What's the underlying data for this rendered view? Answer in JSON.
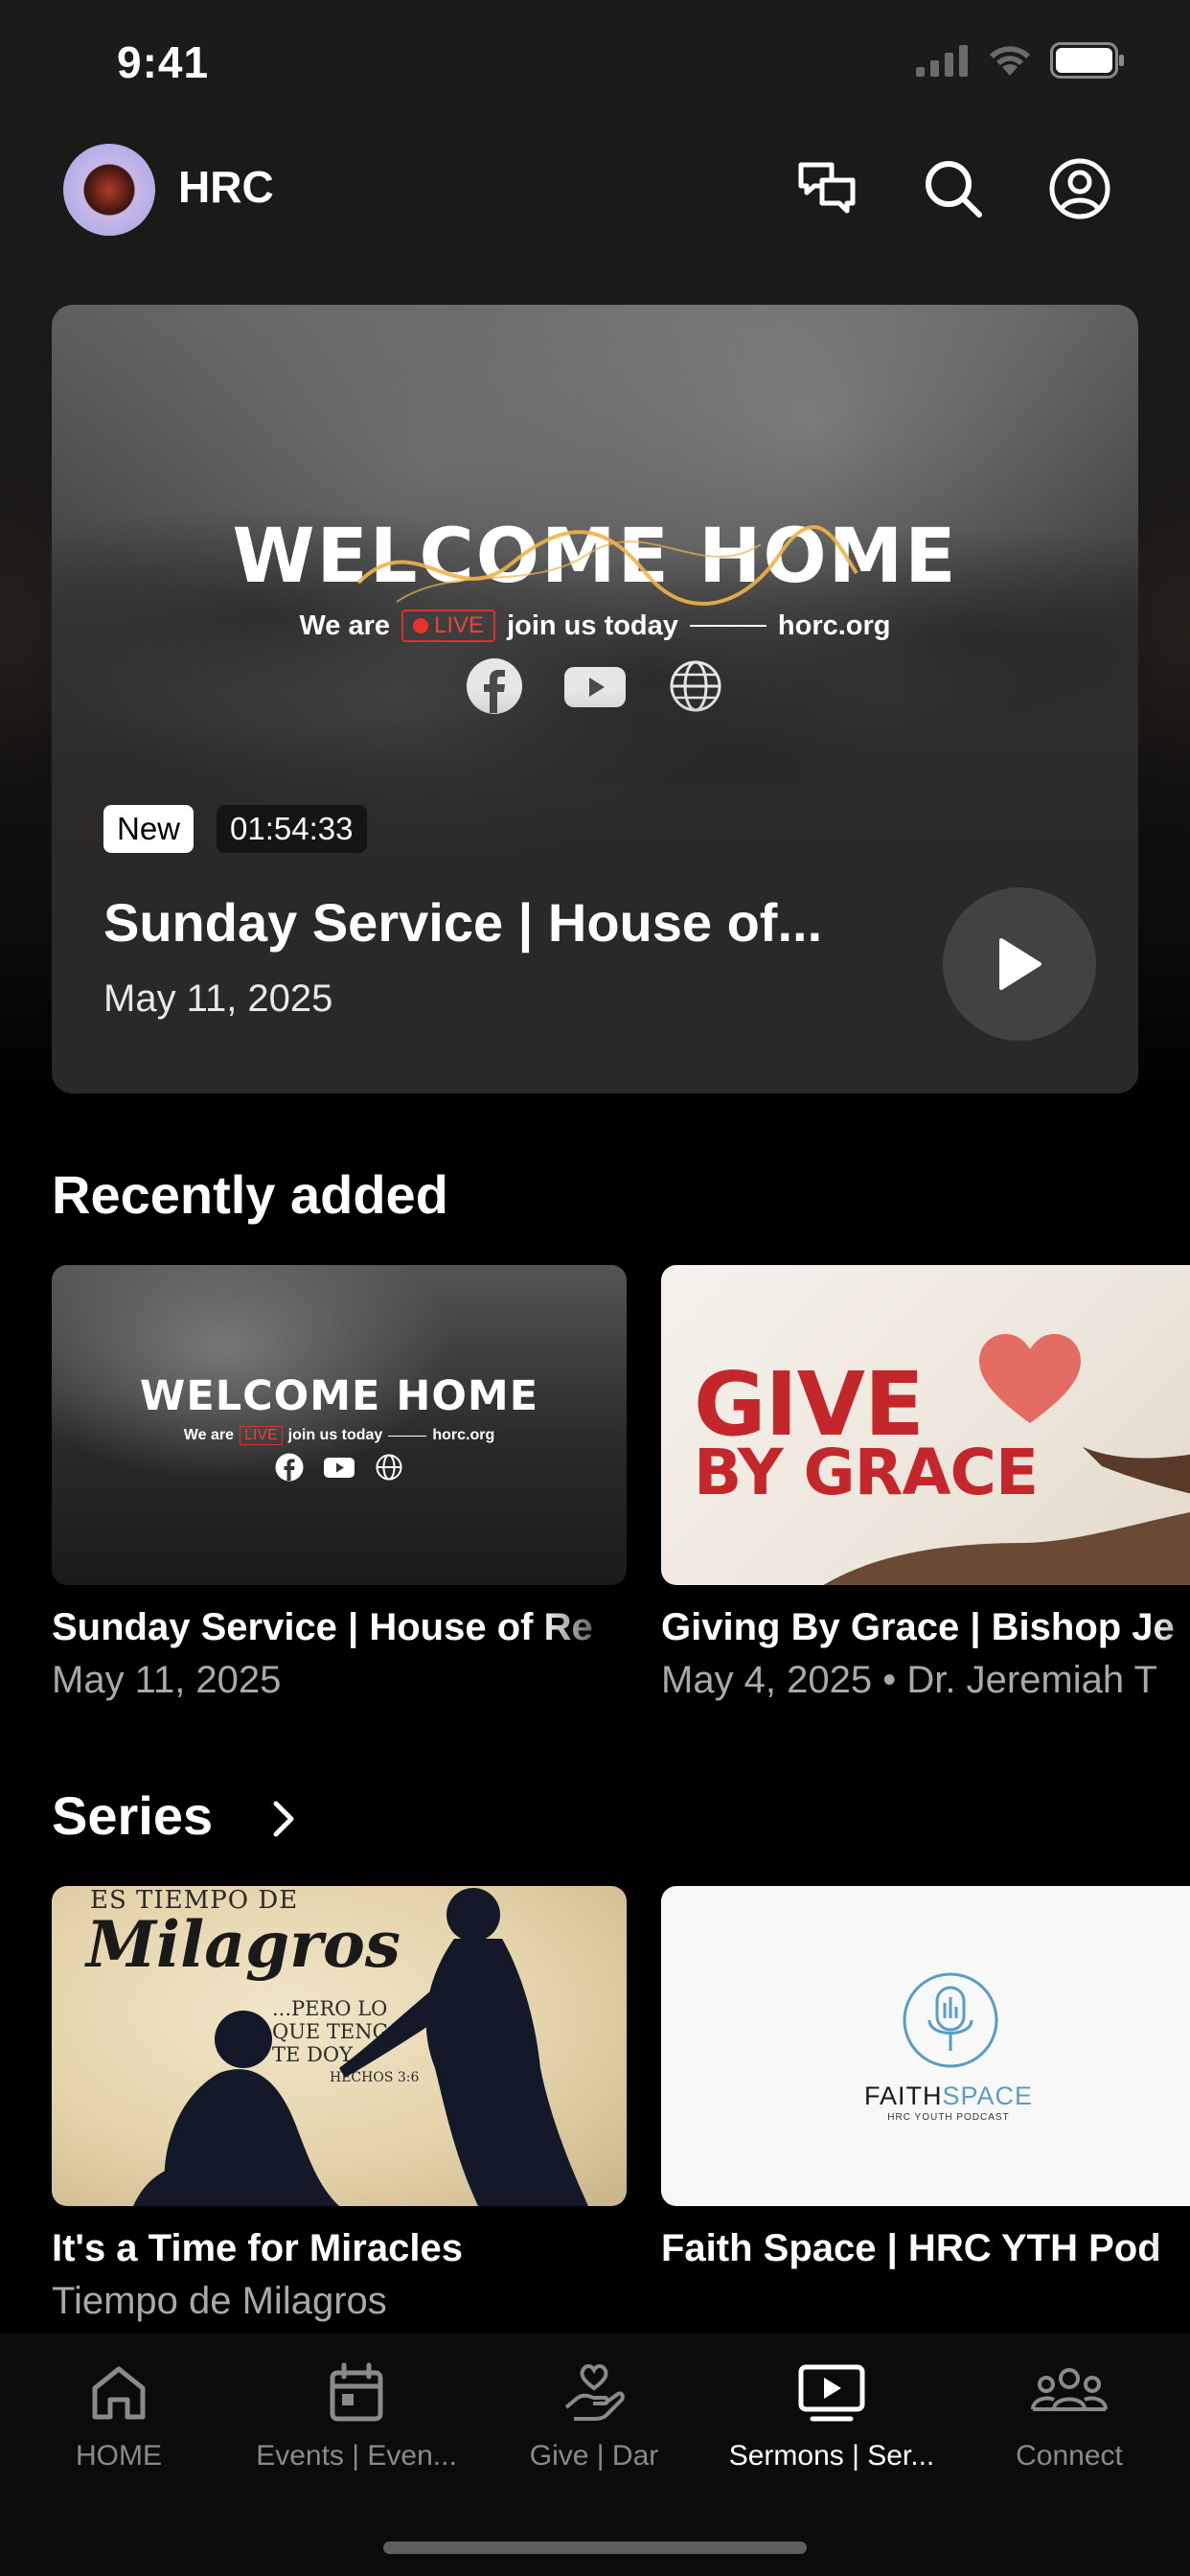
{
  "status_bar": {
    "time": "9:41"
  },
  "header": {
    "app_name": "HRC"
  },
  "hero": {
    "welcome_text": "WELCOME HOME",
    "tagline_prefix": "We are",
    "live_label": "LIVE",
    "tagline_mid": "join us today",
    "website": "horc.org",
    "badge_new": "New",
    "duration": "01:54:33",
    "title": "Sunday Service | House of...",
    "date": "May 11, 2025"
  },
  "recently_added": {
    "title": "Recently added",
    "items": [
      {
        "title": "Sunday Service | House of Re",
        "subtitle": "May 11, 2025",
        "thumb_welcome": "WELCOME HOME",
        "thumb_we_are": "We are",
        "thumb_live": "LIVE",
        "thumb_join": "join us today",
        "thumb_site": "horc.org"
      },
      {
        "title": "Giving By Grace | Bishop Je",
        "subtitle": "May 4, 2025 • Dr. Jeremiah T",
        "thumb_line1": "GIVE",
        "thumb_line2": "BY GRACE"
      }
    ]
  },
  "series": {
    "title": "Series",
    "items": [
      {
        "title": "It's a Time for Miracles",
        "subtitle": "Tiempo de Milagros",
        "thumb_top": "ES TIEMPO DE",
        "thumb_script": "Milagros",
        "thumb_quote_1": "...PERO LO",
        "thumb_quote_2": "QUE TENGO",
        "thumb_quote_3": "TE DOY...\"",
        "thumb_ref": "HECHOS 3:6"
      },
      {
        "title": "Faith Space | HRC YTH Pod",
        "subtitle": "",
        "thumb_brand_1": "FAITH",
        "thumb_brand_2": "SPACE",
        "thumb_caption": "HRC YOUTH PODCAST"
      }
    ]
  },
  "tabbar": {
    "tabs": [
      {
        "label": "HOME",
        "icon": "home-icon"
      },
      {
        "label": "Events | Even...",
        "icon": "calendar-icon"
      },
      {
        "label": "Give | Dar",
        "icon": "give-hand-icon"
      },
      {
        "label": "Sermons | Ser...",
        "icon": "video-play-icon",
        "active": true
      },
      {
        "label": "Connect",
        "icon": "people-icon"
      }
    ]
  },
  "colors": {
    "accent_red": "#c4272b",
    "live_red": "#e8332b",
    "faith_blue": "#4a88b0"
  }
}
